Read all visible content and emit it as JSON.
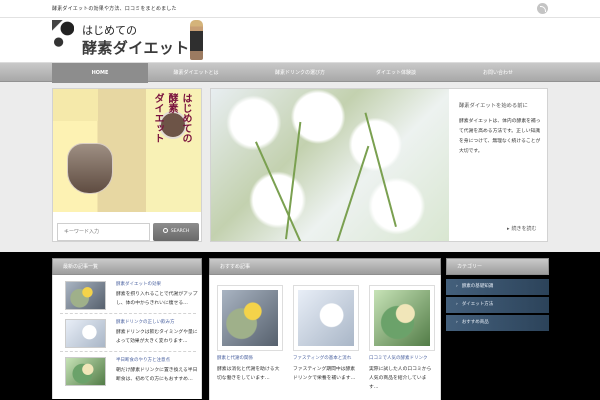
{
  "top_bar": {
    "tagline": "酵素ダイエットの効果や方法、口コミをまとめました",
    "rss_icon": "rss-icon"
  },
  "header": {
    "logo_line1": "はじめての",
    "logo_line2": "酵素ダイエット"
  },
  "nav": {
    "items": [
      {
        "label": "HOME"
      },
      {
        "label": "酵素ダイエットとは"
      },
      {
        "label": "酵素ドリンクの選び方"
      },
      {
        "label": "ダイエット体験談"
      },
      {
        "label": "お問い合わせ"
      }
    ]
  },
  "sidebar_search": {
    "input_placeholder": "キーワード入力",
    "button_label": "SEARCH"
  },
  "promo": {
    "line1": "はじめての",
    "line2": "酵素",
    "line3": "ダイエット"
  },
  "slider": {
    "title": "酵素ダイエットを始める前に",
    "text": "酵素ダイエットは、体内の酵素を補って代謝を高める方法です。正しい知識を身につけて、無理なく続けることが大切です。",
    "more_label": "続きを読む"
  },
  "left_widget": {
    "title": "最新の記事一覧",
    "items": [
      {
        "link": "酵素ダイエットの効果",
        "text": "酵素を摂り入れることで代謝がアップし、体の中からきれいに痩せる…"
      },
      {
        "link": "酵素ドリンクの正しい飲み方",
        "text": "酵素ドリンクは飲むタイミングや量によって効果が大きく変わります…"
      },
      {
        "link": "半日断食のやり方と注意点",
        "text": "朝だけ酵素ドリンクに置き換える半日断食は、初めての方にもおすすめ…"
      }
    ]
  },
  "mid_widget": {
    "title": "おすすめ記事",
    "items": [
      {
        "link": "酵素と代謝の関係",
        "text": "酵素は消化と代謝を助ける大切な働きをしています…"
      },
      {
        "link": "ファスティングの基本と流れ",
        "text": "ファスティング期間中は酵素ドリンクで栄養を補います…"
      },
      {
        "link": "口コミで人気の酵素ドリンク",
        "text": "実際に試した人の口コミから人気の商品を紹介しています…"
      }
    ]
  },
  "right_widget": {
    "title": "カテゴリー",
    "links": [
      {
        "label": "酵素の基礎知識"
      },
      {
        "label": "ダイエット方法"
      },
      {
        "label": "おすすめ商品"
      }
    ]
  }
}
